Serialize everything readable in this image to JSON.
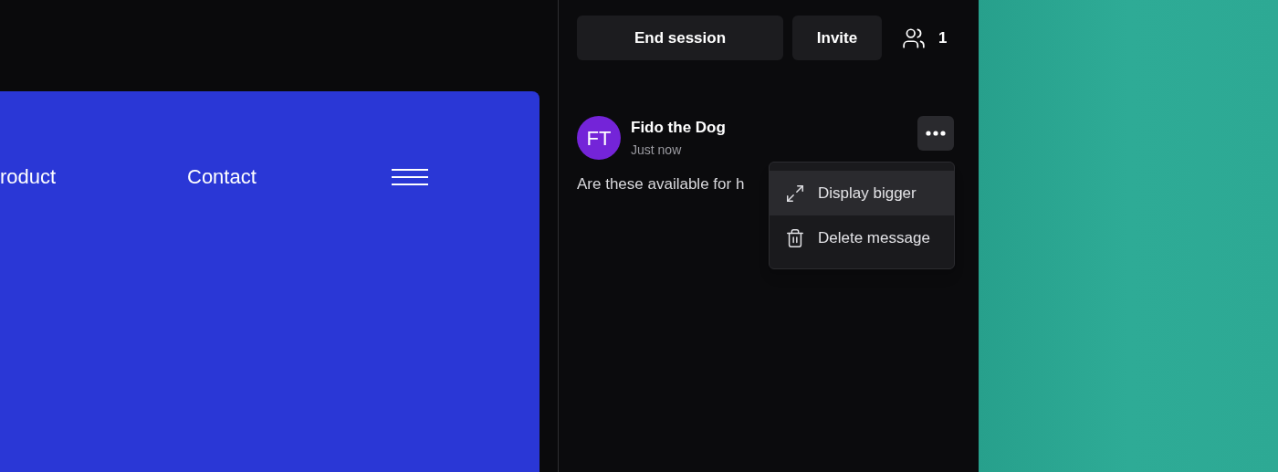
{
  "preview": {
    "nav_links": [
      "roduct",
      "Contact"
    ]
  },
  "session_bar": {
    "buttons": [
      "End session",
      "Invite"
    ],
    "participant_count": "1"
  },
  "message": {
    "initials": "FT",
    "author": "Fido the Dog",
    "time": "Just now",
    "text": "Are these available for h"
  },
  "message_menu": {
    "items": [
      {
        "label": "Display bigger",
        "kind": "expand",
        "selected": true
      },
      {
        "label": "Delete message",
        "kind": "delete",
        "selected": false
      }
    ]
  }
}
